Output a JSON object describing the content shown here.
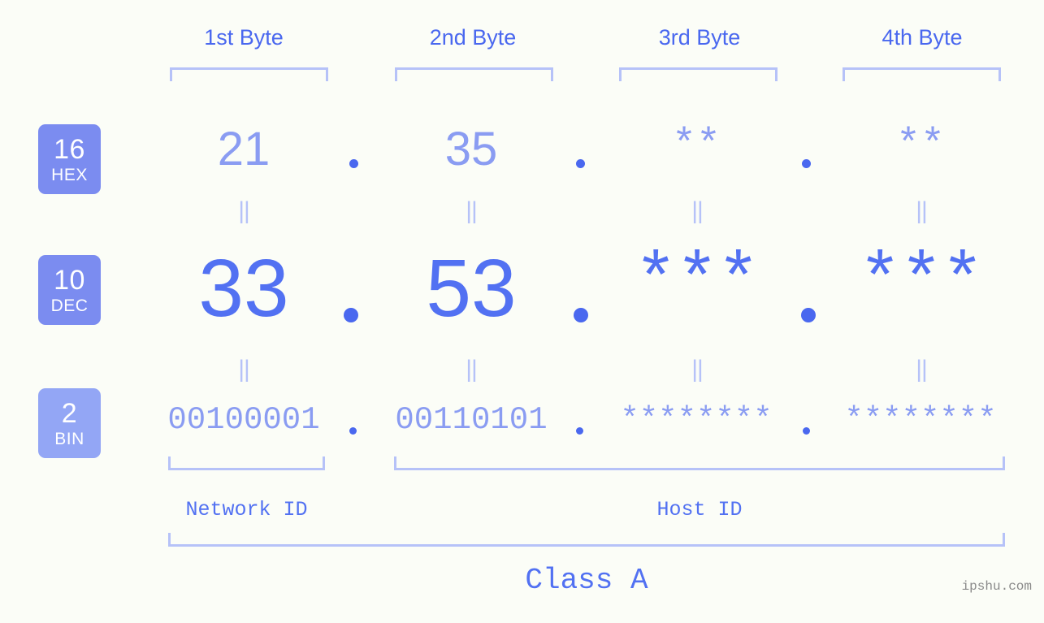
{
  "watermark": "ipshu.com",
  "byte_headers": [
    {
      "label": "1st Byte"
    },
    {
      "label": "2nd Byte"
    },
    {
      "label": "3rd Byte"
    },
    {
      "label": "4th Byte"
    }
  ],
  "bases": [
    {
      "number": "16",
      "name": "HEX"
    },
    {
      "number": "10",
      "name": "DEC"
    },
    {
      "number": "2",
      "name": "BIN"
    }
  ],
  "rows": {
    "hex": {
      "values": [
        "21",
        "35",
        "**",
        "**"
      ],
      "separator": "."
    },
    "dec": {
      "values": [
        "33",
        "53",
        "***",
        "***"
      ],
      "separator": "."
    },
    "bin": {
      "values": [
        "00100001",
        "00110101",
        "********",
        "********"
      ],
      "separator": "."
    }
  },
  "connector": "||",
  "segments": {
    "network_id": "Network ID",
    "host_id": "Host ID"
  },
  "class_label": "Class A",
  "colors": {
    "background": "#fbfdf7",
    "primary": "#5271f2",
    "light": "#8a9cf2",
    "pale": "#b6c2f8",
    "badge_strong": "#7b8cf0",
    "badge_light": "#93a6f5"
  }
}
